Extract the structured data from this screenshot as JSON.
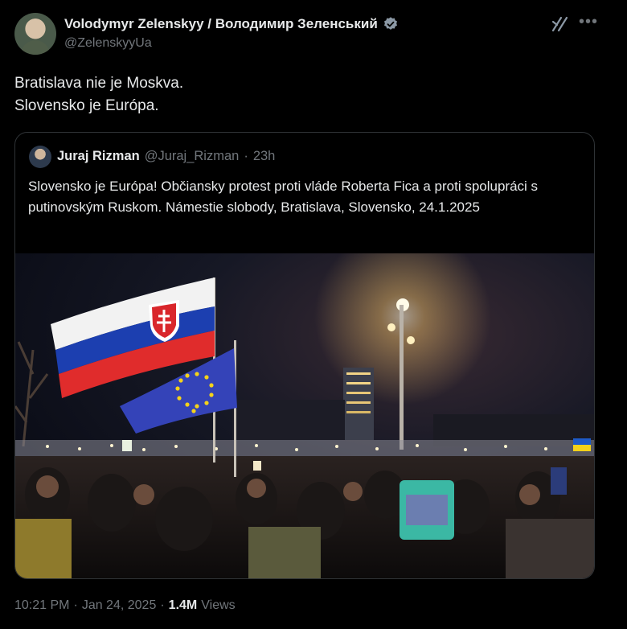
{
  "author": {
    "name": "Volodymyr Zelenskyy / Володимир Зеленський",
    "handle": "@ZelenskyyUa"
  },
  "icons": [
    "verified-badge-icon",
    "grok-icon",
    "more-options-icon"
  ],
  "colors": {
    "verified": "#1d9bf0",
    "background": "#000000",
    "secondary_text": "#71767b",
    "border": "#2f3336"
  },
  "tweet": {
    "line1": "Bratislava nie je Moskva.",
    "line2": "Slovensko je Európa."
  },
  "quote": {
    "name": "Juraj Rizman",
    "handle": "@Juraj_Rizman",
    "time": "23h",
    "separator": "·",
    "text": "Slovensko je Európa! Občiansky protest proti vláde Roberta Fica a proti spolupráci s putinovským Ruskom. Námestie slobody, Bratislava, Slovensko, 24.1.2025"
  },
  "footer": {
    "time": "10:21 PM",
    "sep1": "·",
    "date": "Jan 24, 2025",
    "sep2": "·",
    "views": "1.4M",
    "views_label": "Views"
  }
}
